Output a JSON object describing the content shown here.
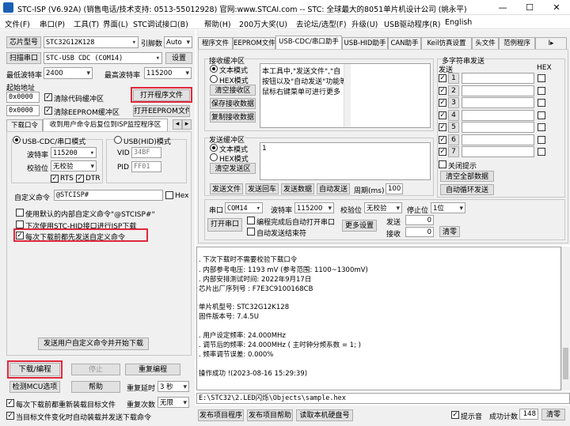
{
  "window": {
    "title": "STC-ISP (V6.92A) (销售电话/技术支持: 0513-55012928) 官网:www.STCAI.com -- STC: 全球最大的8051单片机设计公司 (姚永平)",
    "min": "—",
    "max": "☐",
    "close": "✕"
  },
  "menu": [
    "文件(F)",
    "串口(P)",
    "工具(T)",
    "界面(L)",
    "STC调试接口(B)",
    "帮助(H)",
    "200万大奖(U)",
    "去论坛/选型(F)",
    "升级(U)",
    "USB驱动程序(R)",
    "English"
  ],
  "left": {
    "chip_label": "芯片型号",
    "chip_value": "STC32G12K128",
    "pin_label": "引脚数",
    "pin_value": "Auto",
    "scan_port": "扫描串口",
    "port_value": "STC-USB CDC (COM14)",
    "settings": "设置",
    "min_baud_label": "最低波特率",
    "min_baud": "2400",
    "max_baud_label": "最高波特率",
    "max_baud": "115200",
    "start_addr_label": "起始地址",
    "addr1": "0x0000",
    "clear_code": "清除代码缓冲区",
    "open_prog": "打开程序文件",
    "addr2": "0x0000",
    "clear_eeprom": "清除EEPROM缓冲区",
    "open_eeprom": "打开EEPROM文件",
    "tabs": [
      "下载口令",
      "收到用户命令后复位到ISP监控程序区"
    ],
    "mode_cdc": "USB-CDC/串口模式",
    "mode_hid": "USB(HID)模式",
    "baud_label": "波特率",
    "baud_value": "115200",
    "parity_label": "校验位",
    "parity_value": "无校验",
    "rts": "RTS",
    "dtr": "DTR",
    "vid_label": "VID",
    "vid": "34BF",
    "pid_label": "PID",
    "pid": "FF01",
    "cmd_label": "自定义命令",
    "cmd_value": "@STCISP#",
    "hex": "Hex",
    "opt1": "使用默认的内部自定义命令\"@STCISP#\"",
    "opt2": "下次使用STC-HID接口进行ISP下载",
    "opt3": "每次下载前都先发送自定义命令",
    "send_cmd_btn": "发送用户自定义命令并开始下载",
    "download": "下载/编程",
    "stop": "停止",
    "redownload": "重复编程",
    "detect": "检测MCU选项",
    "help": "帮助",
    "repeat_delay_label": "重复延时",
    "repeat_delay": "3 秒",
    "reload_before": "每次下载前都重新装载目标文件",
    "repeat_count_label": "重复次数",
    "repeat_count": "无限",
    "auto_load": "当目标文件变化时自动装载并发送下载命令"
  },
  "right": {
    "tabs": [
      "程序文件",
      "EEPROM文件",
      "USB-CDC/串口助手",
      "USB-HID助手",
      "CAN助手",
      "Keil仿真设置",
      "头文件",
      "范例程序",
      "I▸"
    ],
    "recv_title": "接收缓冲区",
    "text_mode": "文本模式",
    "hex_mode": "HEX模式",
    "clear_recv": "清空接收区",
    "save_recv": "保存接收数据",
    "copy_recv": "复制接收数据",
    "recv_text": [
      "本工具中,\"发送文件\",\"自",
      "按钮以及\"自动发送\"功能等",
      "鼠标右键菜单可进行更多"
    ],
    "send_title": "发送缓冲区",
    "send_text": "1",
    "clear_send": "清空发送区",
    "send_file": "发送文件",
    "send_enter": "发送回车",
    "send_data": "发送数据",
    "auto_send": "自动发送",
    "period_label": "周期(ms)",
    "period": "100",
    "multi_title": "多字符串发送",
    "send_col": "发送",
    "hex_col": "HEX",
    "multi_rows": [
      "1",
      "2",
      "3",
      "4",
      "5",
      "6",
      "7"
    ],
    "close_tip": "关闭提示",
    "clear_all": "清空全部数据",
    "auto_loop": "自动循环发送",
    "port_label": "串口",
    "port": "COM14",
    "baud_label": "波特率",
    "baud": "115200",
    "parity_label": "校验位",
    "parity": "无校验",
    "stop_label": "停止位",
    "stop": "1位",
    "open_port": "打开串口",
    "auto_open": "编程完成后自动打开串口",
    "auto_send_end": "自动发送结束符",
    "more": "更多设置",
    "sent_label": "发送",
    "sent": "0",
    "recv_label": "接收",
    "recv": "0",
    "clear": "清零"
  },
  "log": {
    "lines": [
      ". 下次下载时不需要校验下载口令",
      ". 内部参考电压: 1193 mV (参考范围: 1100~1300mV)",
      ". 内部安排测试时间: 2022年9月17日",
      "芯片出厂序列号 : F7E3C9100168CB",
      "",
      "单片机型号: STC32G12K128",
      "固件版本号: 7.4.5U",
      "",
      ". 用户设定频率: 24.000MHz",
      ". 调节后的频率: 24.000MHz ( 主时钟分频系数 = 1; )",
      ". 频率调节误差: 0.000%",
      "",
      "操作成功 !(2023-08-16 15:29:39)"
    ],
    "path": "E:\\STC32\\2.LED闪烁\\Objects\\sample.hex",
    "publish_prog": "发布项目程序",
    "publish_help": "发布项目帮助",
    "read_disk": "读取本机硬盘号",
    "hint": "提示音",
    "success_label": "成功计数",
    "success_count": "148",
    "clear": "清零"
  },
  "colors": {
    "highlight": "#e0283c",
    "panel": "#f0f0f0"
  }
}
